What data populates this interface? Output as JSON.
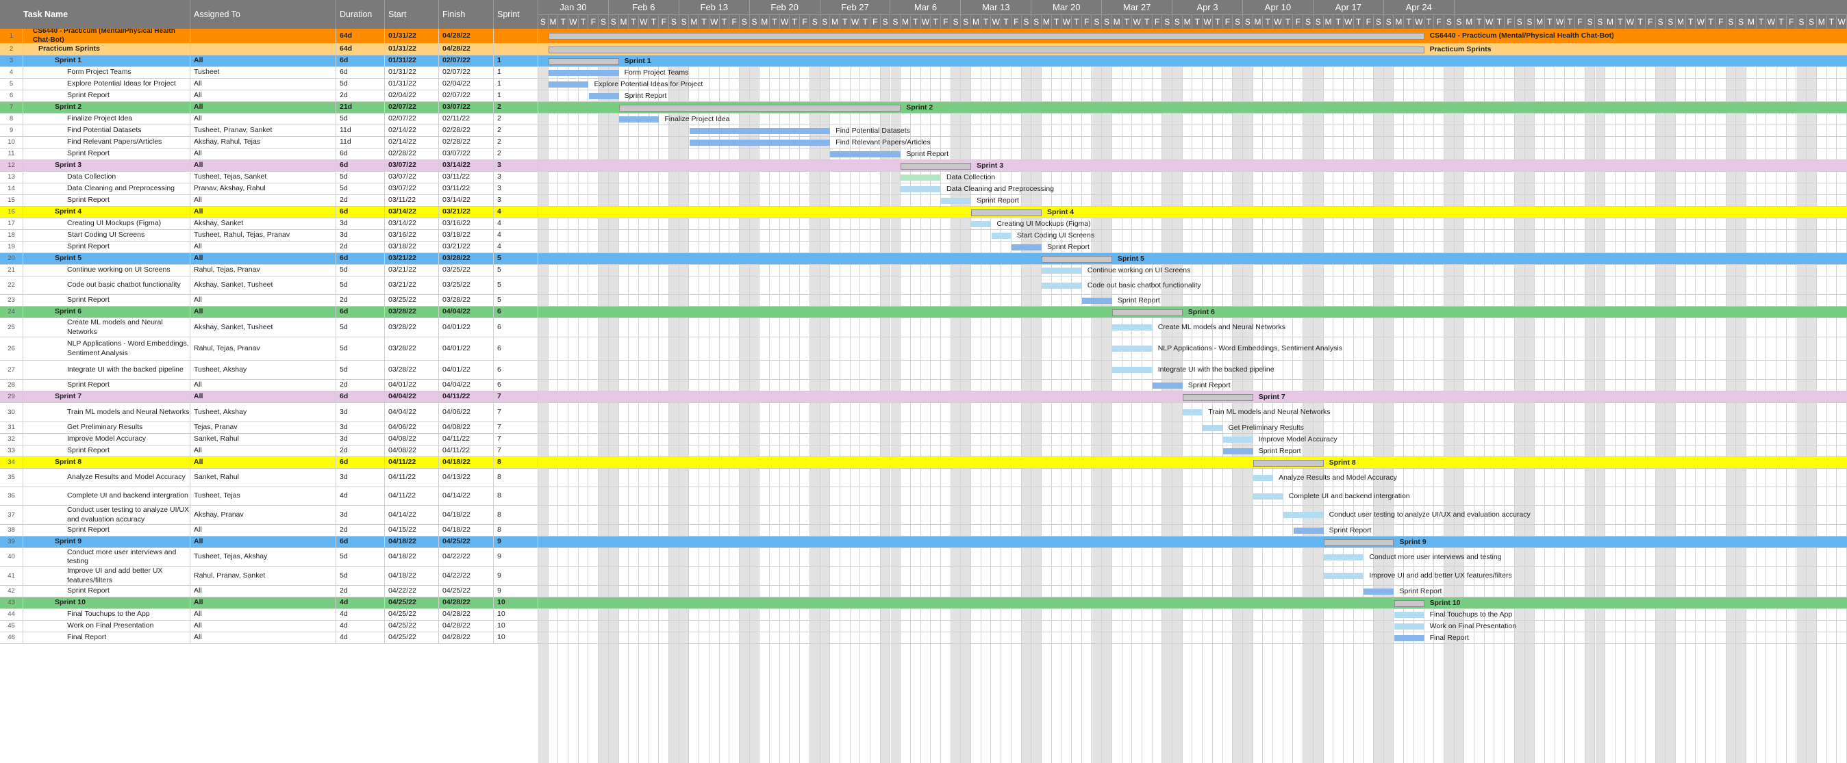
{
  "columns": {
    "task": "Task Name",
    "assigned": "Assigned To",
    "duration": "Duration",
    "start": "Start",
    "finish": "Finish",
    "sprint": "Sprint"
  },
  "weeks": [
    "Jan 30",
    "Feb 6",
    "Feb 13",
    "Feb 20",
    "Feb 27",
    "Mar 6",
    "Mar 13",
    "Mar 20",
    "Mar 27",
    "Apr 3",
    "Apr 10",
    "Apr 17",
    "Apr 24"
  ],
  "day_letters": [
    "S",
    "M",
    "T",
    "W",
    "T",
    "F",
    "S"
  ],
  "colors": {
    "project": "#ff8c00",
    "sprints_group": "#ffd280",
    "blue": "#64b4f0",
    "green": "#78cd82",
    "purple": "#e6c8e6",
    "yellow": "#ffff00",
    "task_light": "#b4dcf0",
    "task_report": "#87b4eb",
    "task_green": "#b4e6c3"
  },
  "rows": [
    {
      "num": "1",
      "task": "CS6440 - Practicum (Mental/Physical Health Chat-Bot)",
      "assigned": "",
      "duration": "64d",
      "start": "01/31/22",
      "finish": "04/28/22",
      "sprint": "",
      "kind": "project",
      "indent": 1,
      "bar": [
        1,
        88
      ],
      "label": "CS6440 - Practicum (Mental/Physical Health Chat-Bot)"
    },
    {
      "num": "2",
      "task": "Practicum Sprints",
      "assigned": "",
      "duration": "64d",
      "start": "01/31/22",
      "finish": "04/28/22",
      "sprint": "",
      "kind": "group",
      "indent": 2,
      "bar": [
        1,
        88
      ],
      "label": "Practicum Sprints"
    },
    {
      "num": "3",
      "task": "Sprint 1",
      "assigned": "All",
      "duration": "6d",
      "start": "01/31/22",
      "finish": "02/07/22",
      "sprint": "1",
      "kind": "sprint",
      "band": "blue",
      "indent": 3,
      "bar": [
        1,
        8
      ],
      "label": "Sprint 1"
    },
    {
      "num": "4",
      "task": "Form Project Teams",
      "assigned": "Tusheet",
      "duration": "6d",
      "start": "01/31/22",
      "finish": "02/07/22",
      "sprint": "1",
      "kind": "task",
      "tcolor": "task_report",
      "indent": 4,
      "bar": [
        1,
        8
      ],
      "label": "Form Project Teams"
    },
    {
      "num": "5",
      "task": "Explore Potential Ideas for Project",
      "assigned": "All",
      "duration": "5d",
      "start": "01/31/22",
      "finish": "02/04/22",
      "sprint": "1",
      "kind": "task",
      "tcolor": "task_report",
      "indent": 4,
      "bar": [
        1,
        5
      ],
      "label": "Explore Potential Ideas for Project"
    },
    {
      "num": "6",
      "task": "Sprint Report",
      "assigned": "All",
      "duration": "2d",
      "start": "02/04/22",
      "finish": "02/07/22",
      "sprint": "1",
      "kind": "task",
      "tcolor": "task_report",
      "indent": 4,
      "bar": [
        5,
        8
      ],
      "label": "Sprint Report"
    },
    {
      "num": "7",
      "task": "Sprint 2",
      "assigned": "All",
      "duration": "21d",
      "start": "02/07/22",
      "finish": "03/07/22",
      "sprint": "2",
      "kind": "sprint",
      "band": "green",
      "indent": 3,
      "bar": [
        8,
        36
      ],
      "label": "Sprint 2"
    },
    {
      "num": "8",
      "task": "Finalize Project Idea",
      "assigned": "All",
      "duration": "5d",
      "start": "02/07/22",
      "finish": "02/11/22",
      "sprint": "2",
      "kind": "task",
      "tcolor": "task_report",
      "indent": 4,
      "bar": [
        8,
        12
      ],
      "label": "Finalize Project Idea"
    },
    {
      "num": "9",
      "task": "Find Potential Datasets",
      "assigned": "Tusheet, Pranav, Sanket",
      "duration": "11d",
      "start": "02/14/22",
      "finish": "02/28/22",
      "sprint": "2",
      "kind": "task",
      "tcolor": "task_report",
      "indent": 4,
      "bar": [
        15,
        29
      ],
      "label": "Find Potential Datasets"
    },
    {
      "num": "10",
      "task": "Find Relevant Papers/Articles",
      "assigned": "Akshay, Rahul, Tejas",
      "duration": "11d",
      "start": "02/14/22",
      "finish": "02/28/22",
      "sprint": "2",
      "kind": "task",
      "tcolor": "task_report",
      "indent": 4,
      "bar": [
        15,
        29
      ],
      "label": "Find Relevant Papers/Articles"
    },
    {
      "num": "11",
      "task": "Sprint Report",
      "assigned": "All",
      "duration": "6d",
      "start": "02/28/22",
      "finish": "03/07/22",
      "sprint": "2",
      "kind": "task",
      "tcolor": "task_report",
      "indent": 4,
      "bar": [
        29,
        36
      ],
      "label": "Sprint Report"
    },
    {
      "num": "12",
      "task": "Sprint 3",
      "assigned": "All",
      "duration": "6d",
      "start": "03/07/22",
      "finish": "03/14/22",
      "sprint": "3",
      "kind": "sprint",
      "band": "purple",
      "indent": 3,
      "bar": [
        36,
        43
      ],
      "label": "Sprint 3"
    },
    {
      "num": "13",
      "task": "Data Collection",
      "assigned": "Tusheet, Tejas, Sanket",
      "duration": "5d",
      "start": "03/07/22",
      "finish": "03/11/22",
      "sprint": "3",
      "kind": "task",
      "tcolor": "task_green",
      "indent": 4,
      "bar": [
        36,
        40
      ],
      "label": "Data Collection"
    },
    {
      "num": "14",
      "task": "Data Cleaning and Preprocessing",
      "assigned": "Pranav, Akshay, Rahul",
      "duration": "5d",
      "start": "03/07/22",
      "finish": "03/11/22",
      "sprint": "3",
      "kind": "task",
      "tcolor": "task_light",
      "indent": 4,
      "bar": [
        36,
        40
      ],
      "label": "Data Cleaning and Preprocessing"
    },
    {
      "num": "15",
      "task": "Sprint Report",
      "assigned": "All",
      "duration": "2d",
      "start": "03/11/22",
      "finish": "03/14/22",
      "sprint": "3",
      "kind": "task",
      "tcolor": "task_light",
      "indent": 4,
      "bar": [
        40,
        43
      ],
      "label": "Sprint Report"
    },
    {
      "num": "16",
      "task": "Sprint 4",
      "assigned": "All",
      "duration": "6d",
      "start": "03/14/22",
      "finish": "03/21/22",
      "sprint": "4",
      "kind": "sprint",
      "band": "yellow",
      "indent": 3,
      "bar": [
        43,
        50
      ],
      "label": "Sprint 4"
    },
    {
      "num": "17",
      "task": "Creating UI Mockups (Figma)",
      "assigned": "Akshay, Sanket",
      "duration": "3d",
      "start": "03/14/22",
      "finish": "03/16/22",
      "sprint": "4",
      "kind": "task",
      "tcolor": "task_light",
      "indent": 4,
      "bar": [
        43,
        45
      ],
      "label": "Creating UI Mockups (Figma)"
    },
    {
      "num": "18",
      "task": "Start Coding UI Screens",
      "assigned": "Tusheet, Rahul, Tejas, Pranav",
      "duration": "3d",
      "start": "03/16/22",
      "finish": "03/18/22",
      "sprint": "4",
      "kind": "task",
      "tcolor": "task_light",
      "indent": 4,
      "bar": [
        45,
        47
      ],
      "label": "Start Coding UI Screens"
    },
    {
      "num": "19",
      "task": "Sprint Report",
      "assigned": "All",
      "duration": "2d",
      "start": "03/18/22",
      "finish": "03/21/22",
      "sprint": "4",
      "kind": "task",
      "tcolor": "task_report",
      "indent": 4,
      "bar": [
        47,
        50
      ],
      "label": "Sprint Report"
    },
    {
      "num": "20",
      "task": "Sprint 5",
      "assigned": "All",
      "duration": "6d",
      "start": "03/21/22",
      "finish": "03/28/22",
      "sprint": "5",
      "kind": "sprint",
      "band": "blue",
      "indent": 3,
      "bar": [
        50,
        57
      ],
      "label": "Sprint 5"
    },
    {
      "num": "21",
      "task": "Continue working on UI Screens",
      "assigned": "Rahul, Tejas, Pranav",
      "duration": "5d",
      "start": "03/21/22",
      "finish": "03/25/22",
      "sprint": "5",
      "kind": "task",
      "tcolor": "task_light",
      "indent": 4,
      "bar": [
        50,
        54
      ],
      "label": "Continue working on UI Screens"
    },
    {
      "num": "22",
      "task": "Code out basic chatbot functionality",
      "assigned": "Akshay, Sanket, Tusheet",
      "duration": "5d",
      "start": "03/21/22",
      "finish": "03/25/22",
      "sprint": "5",
      "kind": "task",
      "tcolor": "task_light",
      "indent": 4,
      "bar": [
        50,
        54
      ],
      "label": "Code out basic chatbot functionality"
    },
    {
      "num": "23",
      "task": "Sprint Report",
      "assigned": "All",
      "duration": "2d",
      "start": "03/25/22",
      "finish": "03/28/22",
      "sprint": "5",
      "kind": "task",
      "tcolor": "task_report",
      "indent": 4,
      "bar": [
        54,
        57
      ],
      "label": "Sprint Report"
    },
    {
      "num": "24",
      "task": "Sprint 6",
      "assigned": "All",
      "duration": "6d",
      "start": "03/28/22",
      "finish": "04/04/22",
      "sprint": "6",
      "kind": "sprint",
      "band": "green",
      "indent": 3,
      "bar": [
        57,
        64
      ],
      "label": "Sprint 6"
    },
    {
      "num": "25",
      "task": "Create ML models and Neural Networks",
      "assigned": "Akshay, Sanket, Tusheet",
      "duration": "5d",
      "start": "03/28/22",
      "finish": "04/01/22",
      "sprint": "6",
      "kind": "task",
      "tcolor": "task_light",
      "indent": 4,
      "bar": [
        57,
        61
      ],
      "label": "Create ML models and Neural Networks"
    },
    {
      "num": "26",
      "task": "NLP Applications - Word Embeddings, Sentiment Analysis",
      "assigned": "Rahul, Tejas, Pranav",
      "duration": "5d",
      "start": "03/28/22",
      "finish": "04/01/22",
      "sprint": "6",
      "kind": "task",
      "tcolor": "task_light",
      "indent": 4,
      "bar": [
        57,
        61
      ],
      "label": "NLP Applications - Word Embeddings, Sentiment Analysis"
    },
    {
      "num": "27",
      "task": "Integrate UI with the backed pipeline",
      "assigned": "Tusheet, Akshay",
      "duration": "5d",
      "start": "03/28/22",
      "finish": "04/01/22",
      "sprint": "6",
      "kind": "task",
      "tcolor": "task_light",
      "indent": 4,
      "bar": [
        57,
        61
      ],
      "label": "Integrate UI with the backed pipeline"
    },
    {
      "num": "28",
      "task": "Sprint Report",
      "assigned": "All",
      "duration": "2d",
      "start": "04/01/22",
      "finish": "04/04/22",
      "sprint": "6",
      "kind": "task",
      "tcolor": "task_report",
      "indent": 4,
      "bar": [
        61,
        64
      ],
      "label": "Sprint Report"
    },
    {
      "num": "29",
      "task": "Sprint 7",
      "assigned": "All",
      "duration": "6d",
      "start": "04/04/22",
      "finish": "04/11/22",
      "sprint": "7",
      "kind": "sprint",
      "band": "purple",
      "indent": 3,
      "bar": [
        64,
        71
      ],
      "label": "Sprint 7"
    },
    {
      "num": "30",
      "task": "Train ML models and Neural Networks",
      "assigned": "Tusheet, Akshay",
      "duration": "3d",
      "start": "04/04/22",
      "finish": "04/06/22",
      "sprint": "7",
      "kind": "task",
      "tcolor": "task_light",
      "indent": 4,
      "bar": [
        64,
        66
      ],
      "label": "Train ML models and Neural Networks"
    },
    {
      "num": "31",
      "task": "Get Preliminary Results",
      "assigned": "Tejas, Pranav",
      "duration": "3d",
      "start": "04/06/22",
      "finish": "04/08/22",
      "sprint": "7",
      "kind": "task",
      "tcolor": "task_light",
      "indent": 4,
      "bar": [
        66,
        68
      ],
      "label": "Get Preliminary Results"
    },
    {
      "num": "32",
      "task": "Improve Model Accuracy",
      "assigned": "Sanket, Rahul",
      "duration": "3d",
      "start": "04/08/22",
      "finish": "04/11/22",
      "sprint": "7",
      "kind": "task",
      "tcolor": "task_light",
      "indent": 4,
      "bar": [
        68,
        71
      ],
      "label": "Improve Model Accuracy"
    },
    {
      "num": "33",
      "task": "Sprint Report",
      "assigned": "All",
      "duration": "2d",
      "start": "04/08/22",
      "finish": "04/11/22",
      "sprint": "7",
      "kind": "task",
      "tcolor": "task_report",
      "indent": 4,
      "bar": [
        68,
        71
      ],
      "label": "Sprint Report"
    },
    {
      "num": "34",
      "task": "Sprint 8",
      "assigned": "All",
      "duration": "6d",
      "start": "04/11/22",
      "finish": "04/18/22",
      "sprint": "8",
      "kind": "sprint",
      "band": "yellow",
      "indent": 3,
      "bar": [
        71,
        78
      ],
      "label": "Sprint 8"
    },
    {
      "num": "35",
      "task": "Analyze Results and Model Accuracy",
      "assigned": "Sanket, Rahul",
      "duration": "3d",
      "start": "04/11/22",
      "finish": "04/13/22",
      "sprint": "8",
      "kind": "task",
      "tcolor": "task_light",
      "indent": 4,
      "bar": [
        71,
        73
      ],
      "label": "Analyze Results and Model Accuracy"
    },
    {
      "num": "36",
      "task": "Complete UI and backend intergration",
      "assigned": "Tusheet, Tejas",
      "duration": "4d",
      "start": "04/11/22",
      "finish": "04/14/22",
      "sprint": "8",
      "kind": "task",
      "tcolor": "task_light",
      "indent": 4,
      "bar": [
        71,
        74
      ],
      "label": "Complete UI and backend intergration"
    },
    {
      "num": "37",
      "task": "Conduct user testing to analyze UI/UX and evaluation accuracy",
      "assigned": "Akshay, Pranav",
      "duration": "3d",
      "start": "04/14/22",
      "finish": "04/18/22",
      "sprint": "8",
      "kind": "task",
      "tcolor": "task_light",
      "indent": 4,
      "bar": [
        74,
        78
      ],
      "label": "Conduct user testing to analyze UI/UX and evaluation accuracy"
    },
    {
      "num": "38",
      "task": "Sprint Report",
      "assigned": "All",
      "duration": "2d",
      "start": "04/15/22",
      "finish": "04/18/22",
      "sprint": "8",
      "kind": "task",
      "tcolor": "task_report",
      "indent": 4,
      "bar": [
        75,
        78
      ],
      "label": "Sprint Report"
    },
    {
      "num": "39",
      "task": "Sprint 9",
      "assigned": "All",
      "duration": "6d",
      "start": "04/18/22",
      "finish": "04/25/22",
      "sprint": "9",
      "kind": "sprint",
      "band": "blue",
      "indent": 3,
      "bar": [
        78,
        85
      ],
      "label": "Sprint 9"
    },
    {
      "num": "40",
      "task": "Conduct more user interviews and testing",
      "assigned": "Tusheet, Tejas, Akshay",
      "duration": "5d",
      "start": "04/18/22",
      "finish": "04/22/22",
      "sprint": "9",
      "kind": "task",
      "tcolor": "task_light",
      "indent": 4,
      "bar": [
        78,
        82
      ],
      "label": "Conduct more user interviews and testing"
    },
    {
      "num": "41",
      "task": "Improve UI and add better UX features/filters",
      "assigned": "Rahul, Pranav, Sanket",
      "duration": "5d",
      "start": "04/18/22",
      "finish": "04/22/22",
      "sprint": "9",
      "kind": "task",
      "tcolor": "task_light",
      "indent": 4,
      "bar": [
        78,
        82
      ],
      "label": "Improve UI and add better UX features/filters"
    },
    {
      "num": "42",
      "task": "Sprint Report",
      "assigned": "All",
      "duration": "2d",
      "start": "04/22/22",
      "finish": "04/25/22",
      "sprint": "9",
      "kind": "task",
      "tcolor": "task_report",
      "indent": 4,
      "bar": [
        82,
        85
      ],
      "label": "Sprint Report"
    },
    {
      "num": "43",
      "task": "Sprint 10",
      "assigned": "All",
      "duration": "4d",
      "start": "04/25/22",
      "finish": "04/28/22",
      "sprint": "10",
      "kind": "sprint",
      "band": "green",
      "indent": 3,
      "bar": [
        85,
        88
      ],
      "label": "Sprint 10"
    },
    {
      "num": "44",
      "task": "Final Touchups to the App",
      "assigned": "All",
      "duration": "4d",
      "start": "04/25/22",
      "finish": "04/28/22",
      "sprint": "10",
      "kind": "task",
      "tcolor": "task_light",
      "indent": 4,
      "bar": [
        85,
        88
      ],
      "label": "Final Touchups to the App"
    },
    {
      "num": "45",
      "task": "Work on Final Presentation",
      "assigned": "All",
      "duration": "4d",
      "start": "04/25/22",
      "finish": "04/28/22",
      "sprint": "10",
      "kind": "task",
      "tcolor": "task_light",
      "indent": 4,
      "bar": [
        85,
        88
      ],
      "label": "Work on Final Presentation"
    },
    {
      "num": "46",
      "task": "Final Report",
      "assigned": "All",
      "duration": "4d",
      "start": "04/25/22",
      "finish": "04/28/22",
      "sprint": "10",
      "kind": "task",
      "tcolor": "task_report",
      "indent": 4,
      "bar": [
        85,
        88
      ],
      "label": "Final Report"
    }
  ]
}
